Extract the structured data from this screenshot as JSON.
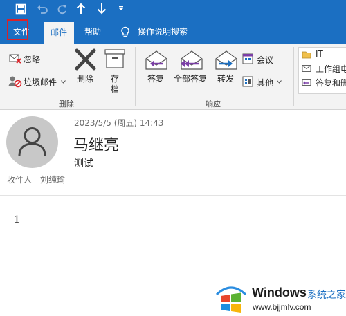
{
  "qat": {
    "save_icon": "save-icon",
    "undo_icon": "undo-icon",
    "redo_icon": "redo-icon",
    "up_icon": "arrow-up-icon",
    "down_icon": "arrow-down-icon",
    "more_icon": "customize-icon"
  },
  "tabs": {
    "file": "文件",
    "mail": "邮件",
    "help": "帮助",
    "tell_me": "操作说明搜索"
  },
  "ribbon": {
    "delete_group": {
      "ignore": "忽略",
      "junk": "垃圾邮件",
      "delete": "删除",
      "archive_1": "存",
      "archive_2": "档",
      "group_label": "删除"
    },
    "respond_group": {
      "reply": "答复",
      "reply_all": "全部答复",
      "forward": "转发",
      "meeting": "会议",
      "more": "其他",
      "group_label": "响应"
    },
    "quick_steps": {
      "it": "IT",
      "team": "工作组电",
      "reply_delete": "答复和删"
    }
  },
  "message": {
    "date": "2023/5/5 (周五) 14:43",
    "sender": "马继亮",
    "subject": "测试",
    "to_label": "收件人",
    "to_name": "刘纯瑜",
    "body": "1"
  },
  "watermark": {
    "brand": "Windows",
    "site_cn": "系统之家",
    "url": "www.bjjmlv.com"
  },
  "colors": {
    "accent": "#1b6fc2",
    "highlight": "#d92229"
  }
}
